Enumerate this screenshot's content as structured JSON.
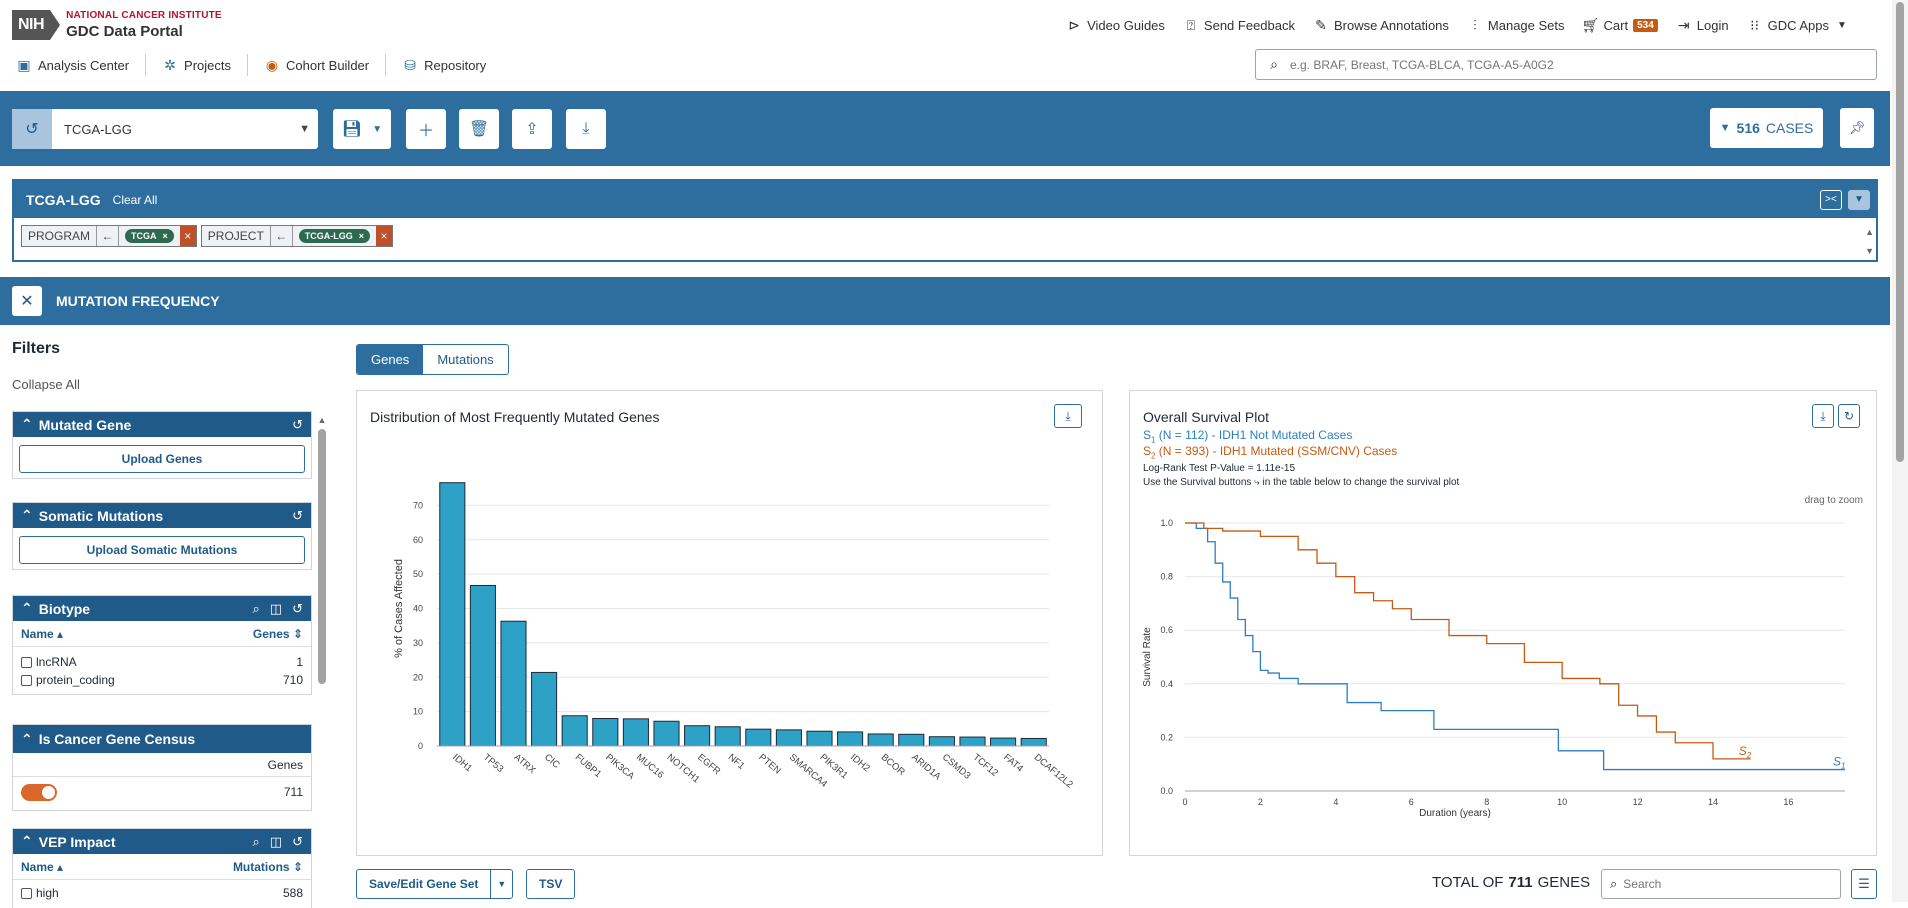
{
  "header": {
    "org": "NATIONAL CANCER INSTITUTE",
    "portal": "GDC Data Portal",
    "nih": "NIH",
    "top_links": [
      {
        "label": "Video Guides",
        "icon": "play-circle-icon"
      },
      {
        "label": "Send Feedback",
        "icon": "feedback-icon"
      },
      {
        "label": "Browse Annotations",
        "icon": "edit-icon"
      },
      {
        "label": "Manage Sets",
        "icon": "sliders-icon"
      },
      {
        "label": "Cart",
        "icon": "cart-icon",
        "badge": "534"
      },
      {
        "label": "Login",
        "icon": "login-icon"
      },
      {
        "label": "GDC Apps",
        "icon": "grid-icon"
      }
    ],
    "nav": [
      {
        "label": "Analysis Center",
        "icon": "analysis-icon"
      },
      {
        "label": "Projects",
        "icon": "projects-icon"
      },
      {
        "label": "Cohort Builder",
        "icon": "cohort-icon"
      },
      {
        "label": "Repository",
        "icon": "database-icon"
      }
    ],
    "search_placeholder": "e.g. BRAF, Breast, TCGA-BLCA, TCGA-A5-A0G2"
  },
  "cohort": {
    "name": "TCGA-LGG",
    "cases_count": "516",
    "cases_label": "CASES"
  },
  "query": {
    "title": "TCGA-LGG",
    "clear_all": "Clear All",
    "filters": [
      {
        "key": "PROGRAM",
        "value": "TCGA"
      },
      {
        "key": "PROJECT",
        "value": "TCGA-LGG"
      }
    ]
  },
  "analysis": {
    "title": "MUTATION FREQUENCY"
  },
  "filters_panel": {
    "title": "Filters",
    "collapse": "Collapse All",
    "mutated_gene": {
      "title": "Mutated Gene",
      "button": "Upload Genes"
    },
    "somatic": {
      "title": "Somatic Mutations",
      "button": "Upload Somatic Mutations"
    },
    "biotype": {
      "title": "Biotype",
      "col_name": "Name",
      "col_count": "Genes",
      "rows": [
        {
          "name": "lncRNA",
          "count": "1"
        },
        {
          "name": "protein_coding",
          "count": "710"
        }
      ]
    },
    "census": {
      "title": "Is Cancer Gene Census",
      "col_count": "Genes",
      "count": "711"
    },
    "vep": {
      "title": "VEP Impact",
      "col_name": "Name",
      "col_count": "Mutations",
      "rows": [
        {
          "name": "high",
          "count": "588"
        }
      ]
    }
  },
  "tabs": {
    "genes": "Genes",
    "mutations": "Mutations"
  },
  "bar_panel": {
    "title": "Distribution of Most Frequently Mutated Genes"
  },
  "surv_panel": {
    "title": "Overall Survival Plot",
    "s1_label": "S",
    "s1_sub": "1",
    "s1_text": " (N = 112) - IDH1 Not Mutated Cases",
    "s2_label": "S",
    "s2_sub": "2",
    "s2_text": " (N = 393) - IDH1 Mutated (SSM/CNV) Cases",
    "pvalue": "Log-Rank Test P-Value = 1.11e-15",
    "hint": "Use the Survival buttons ⤷ in the table below to change the survival plot",
    "zoom": "drag to zoom"
  },
  "bottom": {
    "save_button": "Save/Edit Gene Set",
    "tsv_button": "TSV",
    "total_prefix": "TOTAL OF",
    "total_count": "711",
    "total_suffix": "GENES",
    "search_placeholder": "Search"
  },
  "colors": {
    "primary": "#2e6e9e",
    "bar": "#2ea2c6",
    "s1": "#2b7fc1",
    "s2": "#c65a13",
    "remove": "#c0502a"
  },
  "chart_data": [
    {
      "type": "bar",
      "title": "Distribution of Most Frequently Mutated Genes",
      "xlabel": "",
      "ylabel": "% of Cases Affected",
      "ylim": [
        0,
        80
      ],
      "yticks": [
        0,
        10,
        20,
        30,
        40,
        50,
        60,
        70
      ],
      "categories": [
        "IDH1",
        "TP53",
        "ATRX",
        "CIC",
        "FUBP1",
        "PIK3CA",
        "MUC16",
        "NOTCH1",
        "EGFR",
        "NF1",
        "PTEN",
        "SMARCA4",
        "PIK3R1",
        "IDH2",
        "BCOR",
        "ARID1A",
        "CSMD3",
        "TCF12",
        "FAT4",
        "DCAF12L2"
      ],
      "values": [
        76.6,
        46.7,
        36.3,
        21.4,
        8.8,
        8.0,
        7.9,
        7.2,
        5.9,
        5.6,
        4.9,
        4.7,
        4.3,
        4.1,
        3.5,
        3.4,
        2.7,
        2.6,
        2.3,
        2.2
      ],
      "grid": true
    },
    {
      "type": "line",
      "title": "Overall Survival Plot",
      "xlabel": "Duration (years)",
      "ylabel": "Survival Rate",
      "xlim": [
        0,
        17.5
      ],
      "ylim": [
        0,
        1
      ],
      "xticks": [
        0,
        2,
        4,
        6,
        8,
        10,
        12,
        14,
        16
      ],
      "yticks": [
        0.0,
        0.2,
        0.4,
        0.6,
        0.8,
        1.0
      ],
      "series": [
        {
          "name": "S1",
          "x": [
            0,
            0.3,
            0.6,
            0.8,
            1.0,
            1.2,
            1.4,
            1.6,
            1.8,
            2.0,
            2.2,
            2.5,
            3.0,
            3.5,
            4.3,
            5.2,
            6.6,
            8.0,
            9.9,
            11.1,
            17.5
          ],
          "y": [
            1.0,
            0.98,
            0.93,
            0.85,
            0.78,
            0.72,
            0.64,
            0.58,
            0.52,
            0.45,
            0.44,
            0.42,
            0.4,
            0.4,
            0.33,
            0.3,
            0.23,
            0.23,
            0.15,
            0.08,
            0.08
          ]
        },
        {
          "name": "S2",
          "x": [
            0,
            0.5,
            1.0,
            2.0,
            3.0,
            3.5,
            4.0,
            4.5,
            5.0,
            5.5,
            6.0,
            7.0,
            8.0,
            9.0,
            10.0,
            11.0,
            11.5,
            12.0,
            12.5,
            13.0,
            14.0,
            15.0
          ],
          "y": [
            1.0,
            0.98,
            0.97,
            0.95,
            0.9,
            0.85,
            0.8,
            0.74,
            0.71,
            0.68,
            0.64,
            0.58,
            0.55,
            0.48,
            0.42,
            0.4,
            0.32,
            0.28,
            0.22,
            0.18,
            0.12,
            0.12
          ]
        }
      ]
    }
  ]
}
